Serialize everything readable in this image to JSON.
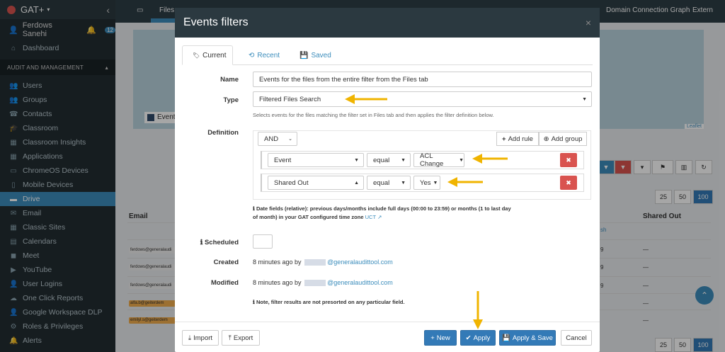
{
  "app": {
    "name": "GAT+"
  },
  "sidebar": {
    "user": "Ferdows Sanehi",
    "notif_count": "12",
    "dashboard": "Dashboard",
    "section": "AUDIT AND MANAGEMENT",
    "items": [
      {
        "label": "Users",
        "icon": "users-icon"
      },
      {
        "label": "Groups",
        "icon": "groups-icon"
      },
      {
        "label": "Contacts",
        "icon": "contacts-icon"
      },
      {
        "label": "Classroom",
        "icon": "classroom-icon"
      },
      {
        "label": "Classroom Insights",
        "icon": "insights-icon"
      },
      {
        "label": "Applications",
        "icon": "apps-icon"
      },
      {
        "label": "ChromeOS Devices",
        "icon": "laptop-icon"
      },
      {
        "label": "Mobile Devices",
        "icon": "mobile-icon"
      },
      {
        "label": "Drive",
        "icon": "drive-icon"
      },
      {
        "label": "Email",
        "icon": "email-icon"
      },
      {
        "label": "Classic Sites",
        "icon": "sites-icon"
      },
      {
        "label": "Calendars",
        "icon": "calendar-icon"
      },
      {
        "label": "Meet",
        "icon": "meet-icon"
      },
      {
        "label": "YouTube",
        "icon": "youtube-icon"
      },
      {
        "label": "User Logins",
        "icon": "logins-icon"
      },
      {
        "label": "One Click Reports",
        "icon": "reports-icon"
      },
      {
        "label": "Google Workspace DLP",
        "icon": "dlp-icon"
      },
      {
        "label": "Roles & Privileges",
        "icon": "roles-icon"
      },
      {
        "label": "Alerts",
        "icon": "alerts-icon"
      }
    ]
  },
  "topbar": {
    "files": "Files",
    "domain_graph": "Domain Connection Graph",
    "external": "Extern"
  },
  "background": {
    "legend": "Event",
    "leaflet": "Leaflet",
    "col_email": "Email",
    "col_shared": "Shared Out",
    "page_sizes": [
      "25",
      "50",
      "100"
    ],
    "row_emails": [
      "ferdows@generalaudi",
      "ferdows@generalaudi",
      "ferdows@generalaudi",
      "alfa.b@geiterdem",
      "emilyl.s@geiterdem"
    ],
    "shared_dash": "—",
    "partial_text": "sh",
    "partial_num": "9"
  },
  "modal": {
    "title": "Events filters",
    "close": "×",
    "tabs": [
      {
        "label": "Current",
        "icon": "tag-icon"
      },
      {
        "label": "Recent",
        "icon": "history-icon"
      },
      {
        "label": "Saved",
        "icon": "save-icon"
      }
    ],
    "name_label": "Name",
    "name_value": "Events for the files from the entire filter from the Files tab",
    "type_label": "Type",
    "type_value": "Filtered Files Search",
    "type_help": "Selects events for the files matching the filter set in Files tab and then applies the filter definition below.",
    "definition_label": "Definition",
    "condition": "AND",
    "add_rule": "Add rule",
    "add_group": "Add group",
    "rules": [
      {
        "field": "Event",
        "operator": "equal",
        "value": "ACL Change"
      },
      {
        "field": "Shared Out",
        "operator": "equal",
        "value": "Yes"
      }
    ],
    "date_note_1": "Date fields (relative): previous days/months include full days (00:00 to 23:59) or months (1 to last day",
    "date_note_2": "of month) in your GAT configured time zone",
    "time_zone": "UCT",
    "scheduled_label": "Scheduled",
    "created_label": "Created",
    "created_prefix": "8 minutes ago by",
    "created_domain": "@generalaudittool.com",
    "modified_label": "Modified",
    "modified_prefix": "8 minutes ago by",
    "modified_domain": "@generalaudittool.com",
    "presort_note": "Note, filter results are not presorted on any particular field.",
    "buttons": {
      "import": "Import",
      "export": "Export",
      "new": "New",
      "apply": "Apply",
      "apply_save": "Apply & Save",
      "cancel": "Cancel"
    }
  },
  "colors": {
    "accent": "#3c8dbc",
    "danger": "#d9534f",
    "arrow": "#f0b400",
    "sidebar": "#222d32"
  }
}
